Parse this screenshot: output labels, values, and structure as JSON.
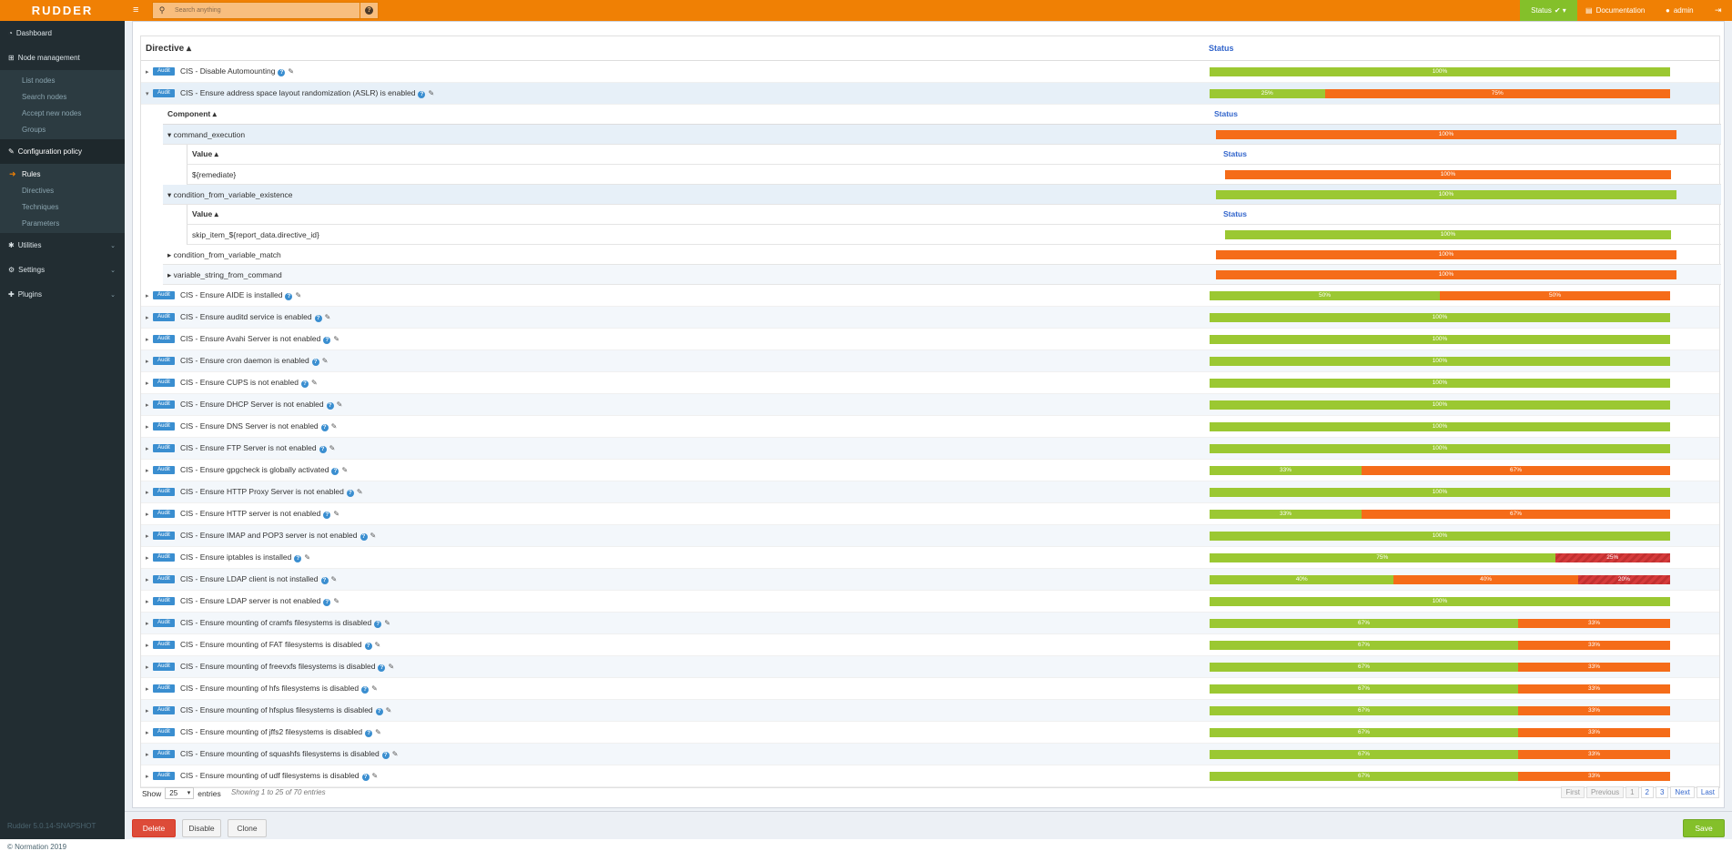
{
  "brand": "RUDDER",
  "search": {
    "placeholder": "Search anything"
  },
  "topbar": {
    "status": "Status",
    "documentation": "Documentation",
    "user": "admin"
  },
  "sidebar": {
    "dashboard": "Dashboard",
    "node_management": "Node management",
    "node_items": [
      "List nodes",
      "Search nodes",
      "Accept new nodes",
      "Groups"
    ],
    "config_policy": "Configuration policy",
    "config_items": [
      "Rules",
      "Directives",
      "Techniques",
      "Parameters"
    ],
    "utilities": "Utilities",
    "settings": "Settings",
    "plugins": "Plugins",
    "version": "Rudder 5.0.14-SNAPSHOT",
    "copyright": "© Normation 2019"
  },
  "table": {
    "col_directive": "Directive",
    "col_status": "Status"
  },
  "badge": "Audit",
  "rows": [
    {
      "name": "CIS - Disable Automounting",
      "segs": [
        [
          "g",
          "100%",
          100
        ]
      ]
    },
    {
      "name": "CIS - Ensure address space layout randomization (ASLR) is enabled",
      "segs": [
        [
          "g",
          "25%",
          25
        ],
        [
          "o",
          "75%",
          75
        ]
      ],
      "open": true
    }
  ],
  "detail": {
    "col_component": "Component",
    "col_status": "Status",
    "col_value": "Value",
    "c1": "command_execution",
    "c1_value": "${remediate}",
    "c2": "condition_from_variable_existence",
    "c2_value": "skip_item_${report_data.directive_id}",
    "c3": "condition_from_variable_match",
    "c4": "variable_string_from_command",
    "pct": "100%"
  },
  "rows2": [
    {
      "name": "CIS - Ensure AIDE is installed",
      "segs": [
        [
          "g",
          "50%",
          50
        ],
        [
          "o",
          "50%",
          50
        ]
      ]
    },
    {
      "name": "CIS - Ensure auditd service is enabled",
      "segs": [
        [
          "g",
          "100%",
          100
        ]
      ]
    },
    {
      "name": "CIS - Ensure Avahi Server is not enabled",
      "segs": [
        [
          "g",
          "100%",
          100
        ]
      ]
    },
    {
      "name": "CIS - Ensure cron daemon is enabled",
      "segs": [
        [
          "g",
          "100%",
          100
        ]
      ]
    },
    {
      "name": "CIS - Ensure CUPS is not enabled",
      "segs": [
        [
          "g",
          "100%",
          100
        ]
      ]
    },
    {
      "name": "CIS - Ensure DHCP Server is not enabled",
      "segs": [
        [
          "g",
          "100%",
          100
        ]
      ]
    },
    {
      "name": "CIS - Ensure DNS Server is not enabled",
      "segs": [
        [
          "g",
          "100%",
          100
        ]
      ]
    },
    {
      "name": "CIS - Ensure FTP Server is not enabled",
      "segs": [
        [
          "g",
          "100%",
          100
        ]
      ]
    },
    {
      "name": "CIS - Ensure gpgcheck is globally activated",
      "segs": [
        [
          "g",
          "33%",
          33
        ],
        [
          "o",
          "67%",
          67
        ]
      ]
    },
    {
      "name": "CIS - Ensure HTTP Proxy Server is not enabled",
      "segs": [
        [
          "g",
          "100%",
          100
        ]
      ]
    },
    {
      "name": "CIS - Ensure HTTP server is not enabled",
      "segs": [
        [
          "g",
          "33%",
          33
        ],
        [
          "o",
          "67%",
          67
        ]
      ]
    },
    {
      "name": "CIS - Ensure IMAP and POP3 server is not enabled",
      "segs": [
        [
          "g",
          "100%",
          100
        ]
      ]
    },
    {
      "name": "CIS - Ensure iptables is installed",
      "segs": [
        [
          "g",
          "75%",
          75
        ],
        [
          "r",
          "25%",
          25
        ]
      ]
    },
    {
      "name": "CIS - Ensure LDAP client is not installed",
      "segs": [
        [
          "g",
          "40%",
          40
        ],
        [
          "o",
          "40%",
          40
        ],
        [
          "r",
          "20%",
          20
        ]
      ]
    },
    {
      "name": "CIS - Ensure LDAP server is not enabled",
      "segs": [
        [
          "g",
          "100%",
          100
        ]
      ]
    },
    {
      "name": "CIS - Ensure mounting of cramfs filesystems is disabled",
      "segs": [
        [
          "g",
          "67%",
          67
        ],
        [
          "o",
          "33%",
          33
        ]
      ]
    },
    {
      "name": "CIS - Ensure mounting of FAT filesystems is disabled",
      "segs": [
        [
          "g",
          "67%",
          67
        ],
        [
          "o",
          "33%",
          33
        ]
      ]
    },
    {
      "name": "CIS - Ensure mounting of freevxfs filesystems is disabled",
      "segs": [
        [
          "g",
          "67%",
          67
        ],
        [
          "o",
          "33%",
          33
        ]
      ]
    },
    {
      "name": "CIS - Ensure mounting of hfs filesystems is disabled",
      "segs": [
        [
          "g",
          "67%",
          67
        ],
        [
          "o",
          "33%",
          33
        ]
      ]
    },
    {
      "name": "CIS - Ensure mounting of hfsplus filesystems is disabled",
      "segs": [
        [
          "g",
          "67%",
          67
        ],
        [
          "o",
          "33%",
          33
        ]
      ]
    },
    {
      "name": "CIS - Ensure mounting of jffs2 filesystems is disabled",
      "segs": [
        [
          "g",
          "67%",
          67
        ],
        [
          "o",
          "33%",
          33
        ]
      ]
    },
    {
      "name": "CIS - Ensure mounting of squashfs filesystems is disabled",
      "segs": [
        [
          "g",
          "67%",
          67
        ],
        [
          "o",
          "33%",
          33
        ]
      ]
    },
    {
      "name": "CIS - Ensure mounting of udf filesystems is disabled",
      "segs": [
        [
          "g",
          "67%",
          67
        ],
        [
          "o",
          "33%",
          33
        ]
      ]
    }
  ],
  "footer": {
    "show": "Show",
    "page_size": "25",
    "entries": "entries",
    "info": "Showing 1 to 25 of 70 entries",
    "pager": [
      "First",
      "Previous",
      "1",
      "2",
      "3",
      "Next",
      "Last"
    ]
  },
  "actions": {
    "delete": "Delete",
    "disable": "Disable",
    "clone": "Clone",
    "save": "Save"
  },
  "colors": {
    "orange": "#f08004",
    "green": "#9bc832",
    "red": "#f56c19",
    "sidebar": "#222d32"
  }
}
